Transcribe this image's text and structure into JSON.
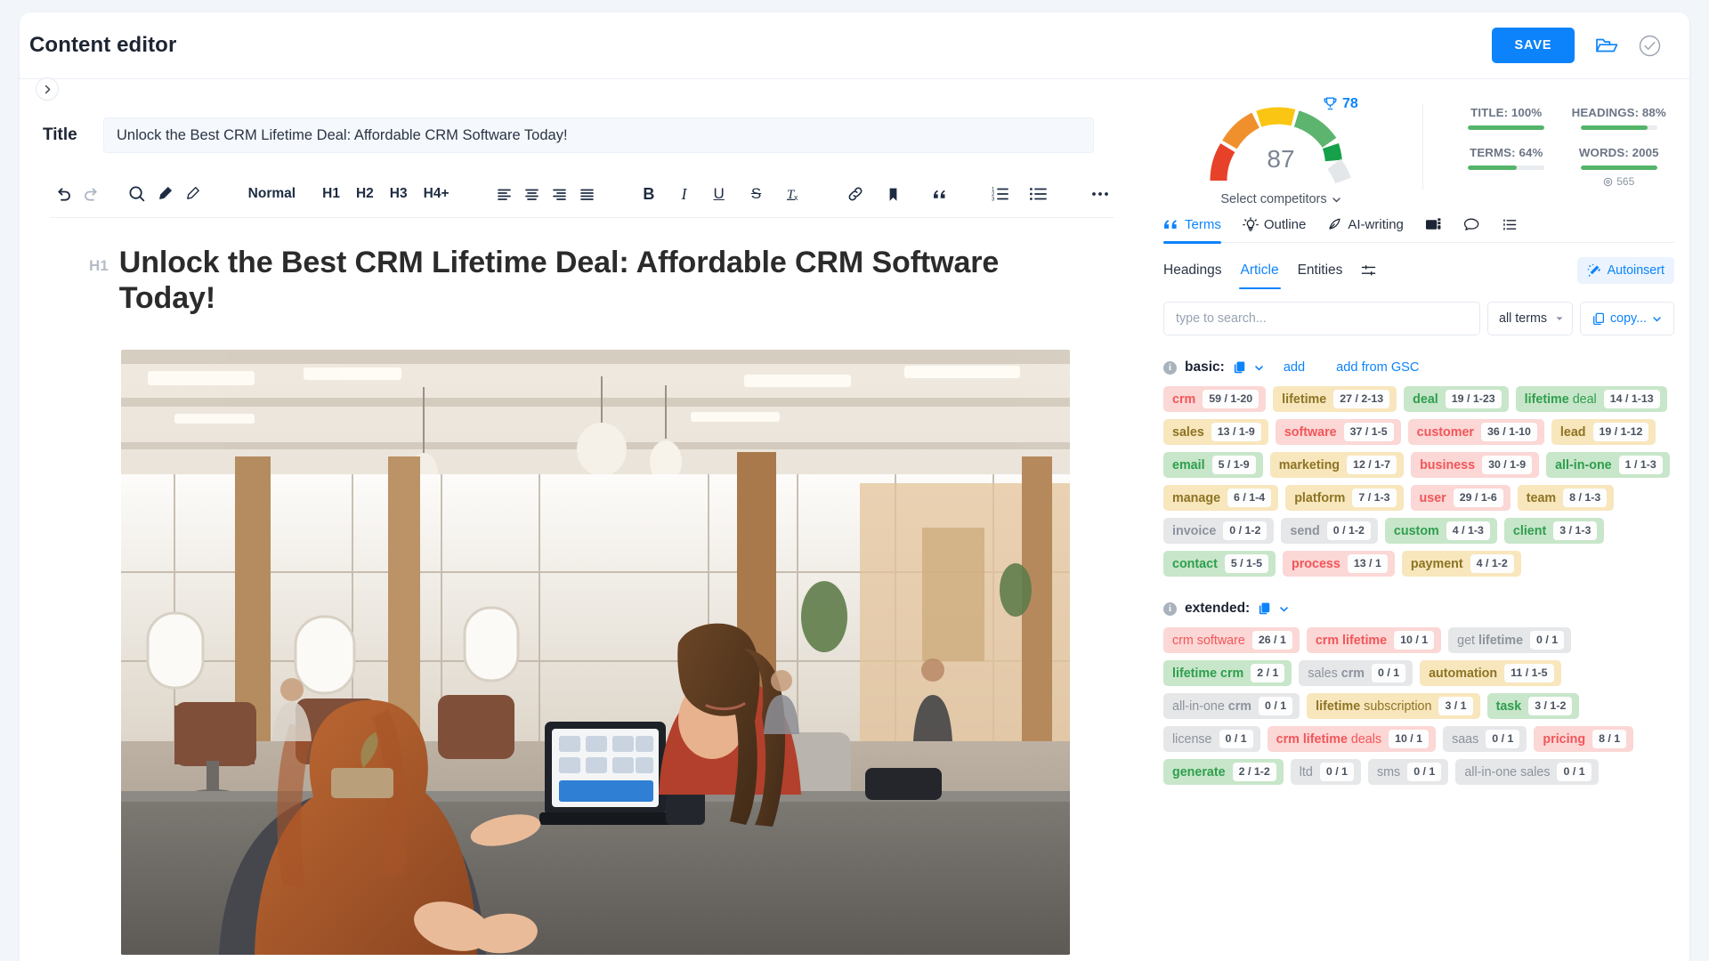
{
  "header": {
    "title": "Content editor",
    "save_label": "SAVE",
    "folder_icon": "open-folder-icon",
    "check_icon": "check-circle-icon",
    "collapse_icon": "chevron-right-icon"
  },
  "editor": {
    "title_label": "Title",
    "title_value": "Unlock the Best CRM Lifetime Deal: Affordable CRM Software Today!",
    "title_placeholder": "Enter title",
    "h1_tag": "H1",
    "h1_text": "Unlock the Best CRM Lifetime Deal: Affordable CRM Software Today!",
    "toolbar": {
      "undo": "undo-icon",
      "redo": "redo-icon",
      "search": "search-icon",
      "marker": "marker-icon",
      "highlighter": "highlighter-icon",
      "styles": [
        "Normal",
        "H1",
        "H2",
        "H3",
        "H4+"
      ],
      "align": [
        "align-left-icon",
        "align-center-icon",
        "align-right-icon",
        "align-justify-icon"
      ],
      "bold": "B",
      "italic": "I",
      "underline": "U",
      "strike": "S",
      "clear_format": "Tx",
      "link": "link-icon",
      "bookmark": "bookmark-icon",
      "quote": "quote-icon",
      "ordered_list": "ordered-list-icon",
      "bullet_list": "bullet-list-icon",
      "more": "more-horizontal-icon"
    }
  },
  "panel": {
    "score": {
      "value": "87",
      "competitor_value": "78",
      "competitor_icon": "trophy-icon",
      "select_competitors": "Select competitors",
      "gauge_colors": [
        "#e8412a",
        "#f0902c",
        "#fbc513",
        "#5cb46f",
        "#16a04a",
        "#e4e7ea"
      ]
    },
    "metrics": [
      {
        "label": "TITLE: 100%",
        "pct": 100,
        "sub": ""
      },
      {
        "label": "HEADINGS: 88%",
        "pct": 88,
        "sub": ""
      },
      {
        "label": "TERMS: 64%",
        "pct": 64,
        "sub": ""
      },
      {
        "label": "WORDS: 2005",
        "pct": 100,
        "sub": "565",
        "sub_icon": "target-icon"
      }
    ],
    "tabs": [
      {
        "label": "Terms",
        "icon": "quotes-icon",
        "active": true
      },
      {
        "label": "Outline",
        "icon": "bulb-icon",
        "active": false
      },
      {
        "label": "AI-writing",
        "icon": "pen-icon",
        "active": false
      },
      {
        "label": "",
        "icon": "images-icon",
        "active": false
      },
      {
        "label": "",
        "icon": "chat-icon",
        "active": false
      },
      {
        "label": "",
        "icon": "list-icon",
        "active": false
      }
    ],
    "subtabs": [
      {
        "label": "Headings",
        "active": false
      },
      {
        "label": "Article",
        "active": true
      },
      {
        "label": "Entities",
        "active": false
      }
    ],
    "subtabs_settings_icon": "sliders-icon",
    "autoinsert": {
      "label": "Autoinsert",
      "icon": "magic-wand-icon"
    },
    "search": {
      "placeholder": "type to search...",
      "value": "",
      "filter_label": "all terms",
      "filter_caret": "chevron-down-icon",
      "copy_label": "copy...",
      "copy_icon": "copy-icon"
    },
    "groups": [
      {
        "name": "basic:",
        "copy_icon": "copy-icon",
        "caret_icon": "chevron-down-icon",
        "links": [
          "add",
          "add from GSC"
        ],
        "terms": [
          {
            "label": "crm",
            "bold": "crm",
            "plain": "",
            "count": "59 / 1-20",
            "tone": "red"
          },
          {
            "label": "lifetime",
            "bold": "lifetime",
            "plain": "",
            "count": "27 / 2-13",
            "tone": "yel"
          },
          {
            "label": "deal",
            "bold": "deal",
            "plain": "",
            "count": "19 / 1-23",
            "tone": "grn"
          },
          {
            "label": "lifetime deal",
            "bold": "lifetime",
            "plain": " deal",
            "count": "14 / 1-13",
            "tone": "grn"
          },
          {
            "label": "sales",
            "bold": "sales",
            "plain": "",
            "count": "13 / 1-9",
            "tone": "yel"
          },
          {
            "label": "software",
            "bold": "software",
            "plain": "",
            "count": "37 / 1-5",
            "tone": "red"
          },
          {
            "label": "customer",
            "bold": "customer",
            "plain": "",
            "count": "36 / 1-10",
            "tone": "red"
          },
          {
            "label": "lead",
            "bold": "lead",
            "plain": "",
            "count": "19 / 1-12",
            "tone": "yel"
          },
          {
            "label": "email",
            "bold": "email",
            "plain": "",
            "count": "5 / 1-9",
            "tone": "grn"
          },
          {
            "label": "marketing",
            "bold": "marketing",
            "plain": "",
            "count": "12 / 1-7",
            "tone": "yel"
          },
          {
            "label": "business",
            "bold": "business",
            "plain": "",
            "count": "30 / 1-9",
            "tone": "red"
          },
          {
            "label": "all-in-one",
            "bold": "all-in-one",
            "plain": "",
            "count": "1 / 1-3",
            "tone": "grn"
          },
          {
            "label": "manage",
            "bold": "manage",
            "plain": "",
            "count": "6 / 1-4",
            "tone": "yel"
          },
          {
            "label": "platform",
            "bold": "platform",
            "plain": "",
            "count": "7 / 1-3",
            "tone": "yel"
          },
          {
            "label": "user",
            "bold": "user",
            "plain": "",
            "count": "29 / 1-6",
            "tone": "red"
          },
          {
            "label": "team",
            "bold": "team",
            "plain": "",
            "count": "8 / 1-3",
            "tone": "yel"
          },
          {
            "label": "invoice",
            "bold": "invoice",
            "plain": "",
            "count": "0 / 1-2",
            "tone": "gry"
          },
          {
            "label": "send",
            "bold": "send",
            "plain": "",
            "count": "0 / 1-2",
            "tone": "gry"
          },
          {
            "label": "custom",
            "bold": "custom",
            "plain": "",
            "count": "4 / 1-3",
            "tone": "grn"
          },
          {
            "label": "client",
            "bold": "client",
            "plain": "",
            "count": "3 / 1-3",
            "tone": "grn"
          },
          {
            "label": "contact",
            "bold": "contact",
            "plain": "",
            "count": "5 / 1-5",
            "tone": "grn"
          },
          {
            "label": "process",
            "bold": "process",
            "plain": "",
            "count": "13 / 1",
            "tone": "red"
          },
          {
            "label": "payment",
            "bold": "payment",
            "plain": "",
            "count": "4 / 1-2",
            "tone": "yel"
          }
        ]
      },
      {
        "name": "extended:",
        "copy_icon": "copy-icon",
        "caret_icon": "chevron-down-icon",
        "links": [],
        "terms": [
          {
            "label": "crm software",
            "bold": "",
            "plain": "crm software",
            "count": "26 / 1",
            "tone": "red"
          },
          {
            "label": "crm lifetime",
            "bold": "crm lifetime",
            "plain": "",
            "count": "10 / 1",
            "tone": "red"
          },
          {
            "label": "get lifetime",
            "bold": "lifetime",
            "plain": "get ",
            "count": "0 / 1",
            "tone": "gry",
            "leading_plain": true
          },
          {
            "label": "lifetime crm",
            "bold": "lifetime crm",
            "plain": "",
            "count": "2 / 1",
            "tone": "grn"
          },
          {
            "label": "sales crm",
            "bold": "crm",
            "plain": "sales ",
            "count": "0 / 1",
            "tone": "gry",
            "leading_plain": true
          },
          {
            "label": "automation",
            "bold": "automation",
            "plain": "",
            "count": "11 / 1-5",
            "tone": "yel"
          },
          {
            "label": "all-in-one crm",
            "bold": "crm",
            "plain": "all-in-one ",
            "count": "0 / 1",
            "tone": "gry",
            "leading_plain": true
          },
          {
            "label": "lifetime subscription",
            "bold": "lifetime",
            "plain": " subscription",
            "count": "3 / 1",
            "tone": "yel"
          },
          {
            "label": "task",
            "bold": "task",
            "plain": "",
            "count": "3 / 1-2",
            "tone": "grn"
          },
          {
            "label": "license",
            "bold": "",
            "plain": "license",
            "count": "0 / 1",
            "tone": "gry"
          },
          {
            "label": "crm lifetime deals",
            "bold": "crm lifetime",
            "plain": " deals",
            "count": "10 / 1",
            "tone": "red"
          },
          {
            "label": "saas",
            "bold": "",
            "plain": "saas",
            "count": "0 / 1",
            "tone": "gry"
          },
          {
            "label": "pricing",
            "bold": "pricing",
            "plain": "",
            "count": "8 / 1",
            "tone": "red"
          },
          {
            "label": "generate",
            "bold": "generate",
            "plain": "",
            "count": "2 / 1-2",
            "tone": "grn"
          },
          {
            "label": "ltd",
            "bold": "",
            "plain": "ltd",
            "count": "0 / 1",
            "tone": "gry"
          },
          {
            "label": "sms",
            "bold": "",
            "plain": "sms",
            "count": "0 / 1",
            "tone": "gry"
          },
          {
            "label": "all-in-one sales",
            "bold": "",
            "plain": "all-in-one sales",
            "count": "0 / 1",
            "tone": "gry"
          }
        ]
      }
    ]
  }
}
